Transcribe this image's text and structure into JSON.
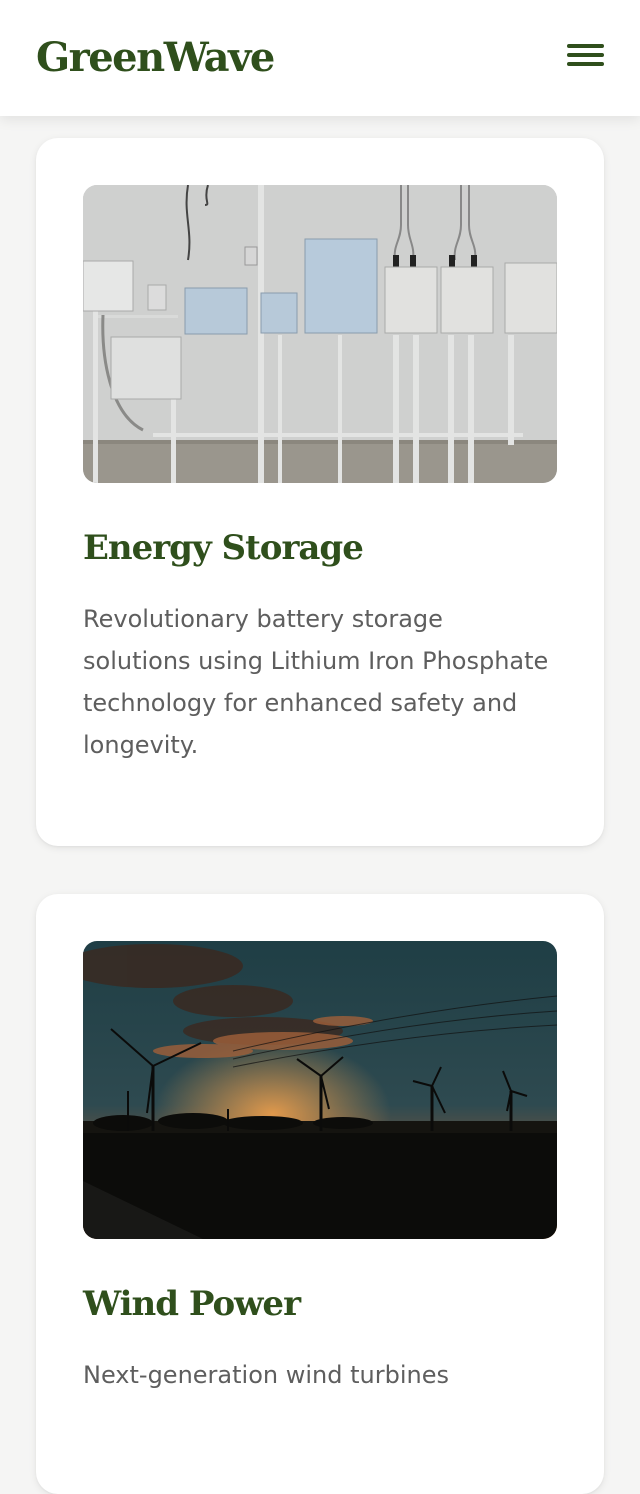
{
  "header": {
    "logo": "GreenWave",
    "menu_icon": "hamburger-menu-icon"
  },
  "cards": [
    {
      "image": "electrical-panels-photo",
      "title": "Energy Storage",
      "description": "Revolutionary battery storage solutions using Lithium Iron Phosphate technology for enhanced safety and longevity."
    },
    {
      "image": "wind-turbines-sunset-photo",
      "title": "Wind Power",
      "description": "Next-generation wind turbines"
    }
  ],
  "colors": {
    "brand": "#2f4f1c",
    "text_muted": "#5e5e5e",
    "page_bg": "#f5f5f4",
    "card_bg": "#ffffff"
  }
}
